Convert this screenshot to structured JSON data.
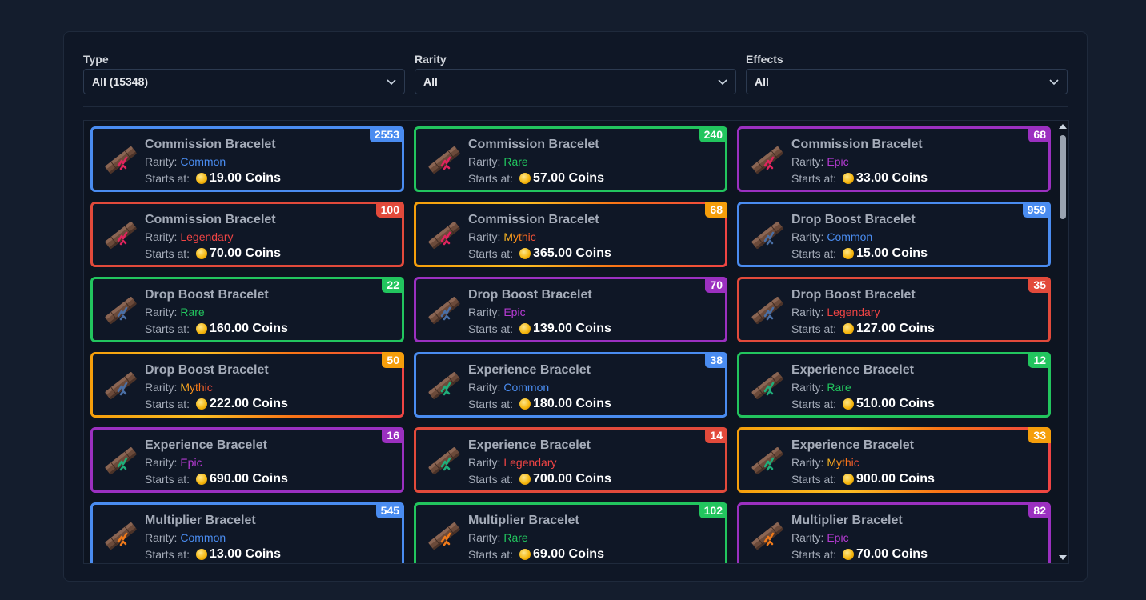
{
  "filters": [
    {
      "label": "Type",
      "value": "All (15348)"
    },
    {
      "label": "Rarity",
      "value": "All"
    },
    {
      "label": "Effects",
      "value": "All"
    }
  ],
  "labels": {
    "rarity_prefix": "Rarity:",
    "starts_at": "Starts at:"
  },
  "colors": {
    "common": "#4a8cf0",
    "rare": "#22c55e",
    "epic": "#9b30c0",
    "legendary": "#e24a3b",
    "mythic": "#f59e0b",
    "commission_gem": "#e0245e",
    "drop_boost_gem": "#4a6fa5",
    "experience_gem": "#1fae7a",
    "multiplier_gem": "#f07a1a"
  },
  "items": [
    {
      "name": "Commission Bracelet",
      "rarity": "Common",
      "tier": "common",
      "count": "2553",
      "price": "19.00 Coins",
      "icon": "commission-bracelet-icon",
      "gem": "commission_gem"
    },
    {
      "name": "Commission Bracelet",
      "rarity": "Rare",
      "tier": "rare",
      "count": "240",
      "price": "57.00 Coins",
      "icon": "commission-bracelet-icon",
      "gem": "commission_gem"
    },
    {
      "name": "Commission Bracelet",
      "rarity": "Epic",
      "tier": "epic",
      "count": "68",
      "price": "33.00 Coins",
      "icon": "commission-bracelet-icon",
      "gem": "commission_gem"
    },
    {
      "name": "Commission Bracelet",
      "rarity": "Legendary",
      "tier": "legendary",
      "count": "100",
      "price": "70.00 Coins",
      "icon": "commission-bracelet-icon",
      "gem": "commission_gem"
    },
    {
      "name": "Commission Bracelet",
      "rarity": "Mythic",
      "tier": "mythic",
      "count": "68",
      "price": "365.00 Coins",
      "icon": "commission-bracelet-icon",
      "gem": "commission_gem"
    },
    {
      "name": "Drop Boost Bracelet",
      "rarity": "Common",
      "tier": "common",
      "count": "959",
      "price": "15.00 Coins",
      "icon": "drop-boost-bracelet-icon",
      "gem": "drop_boost_gem"
    },
    {
      "name": "Drop Boost Bracelet",
      "rarity": "Rare",
      "tier": "rare",
      "count": "22",
      "price": "160.00 Coins",
      "icon": "drop-boost-bracelet-icon",
      "gem": "drop_boost_gem"
    },
    {
      "name": "Drop Boost Bracelet",
      "rarity": "Epic",
      "tier": "epic",
      "count": "70",
      "price": "139.00 Coins",
      "icon": "drop-boost-bracelet-icon",
      "gem": "drop_boost_gem"
    },
    {
      "name": "Drop Boost Bracelet",
      "rarity": "Legendary",
      "tier": "legendary",
      "count": "35",
      "price": "127.00 Coins",
      "icon": "drop-boost-bracelet-icon",
      "gem": "drop_boost_gem"
    },
    {
      "name": "Drop Boost Bracelet",
      "rarity": "Mythic",
      "tier": "mythic",
      "count": "50",
      "price": "222.00 Coins",
      "icon": "drop-boost-bracelet-icon",
      "gem": "drop_boost_gem"
    },
    {
      "name": "Experience Bracelet",
      "rarity": "Common",
      "tier": "common",
      "count": "38",
      "price": "180.00 Coins",
      "icon": "experience-bracelet-icon",
      "gem": "experience_gem"
    },
    {
      "name": "Experience Bracelet",
      "rarity": "Rare",
      "tier": "rare",
      "count": "12",
      "price": "510.00 Coins",
      "icon": "experience-bracelet-icon",
      "gem": "experience_gem"
    },
    {
      "name": "Experience Bracelet",
      "rarity": "Epic",
      "tier": "epic",
      "count": "16",
      "price": "690.00 Coins",
      "icon": "experience-bracelet-icon",
      "gem": "experience_gem"
    },
    {
      "name": "Experience Bracelet",
      "rarity": "Legendary",
      "tier": "legendary",
      "count": "14",
      "price": "700.00 Coins",
      "icon": "experience-bracelet-icon",
      "gem": "experience_gem"
    },
    {
      "name": "Experience Bracelet",
      "rarity": "Mythic",
      "tier": "mythic",
      "count": "33",
      "price": "900.00 Coins",
      "icon": "experience-bracelet-icon",
      "gem": "experience_gem"
    },
    {
      "name": "Multiplier Bracelet",
      "rarity": "Common",
      "tier": "common",
      "count": "545",
      "price": "13.00 Coins",
      "icon": "multiplier-bracelet-icon",
      "gem": "multiplier_gem"
    },
    {
      "name": "Multiplier Bracelet",
      "rarity": "Rare",
      "tier": "rare",
      "count": "102",
      "price": "69.00 Coins",
      "icon": "multiplier-bracelet-icon",
      "gem": "multiplier_gem"
    },
    {
      "name": "Multiplier Bracelet",
      "rarity": "Epic",
      "tier": "epic",
      "count": "82",
      "price": "70.00 Coins",
      "icon": "multiplier-bracelet-icon",
      "gem": "multiplier_gem"
    }
  ]
}
